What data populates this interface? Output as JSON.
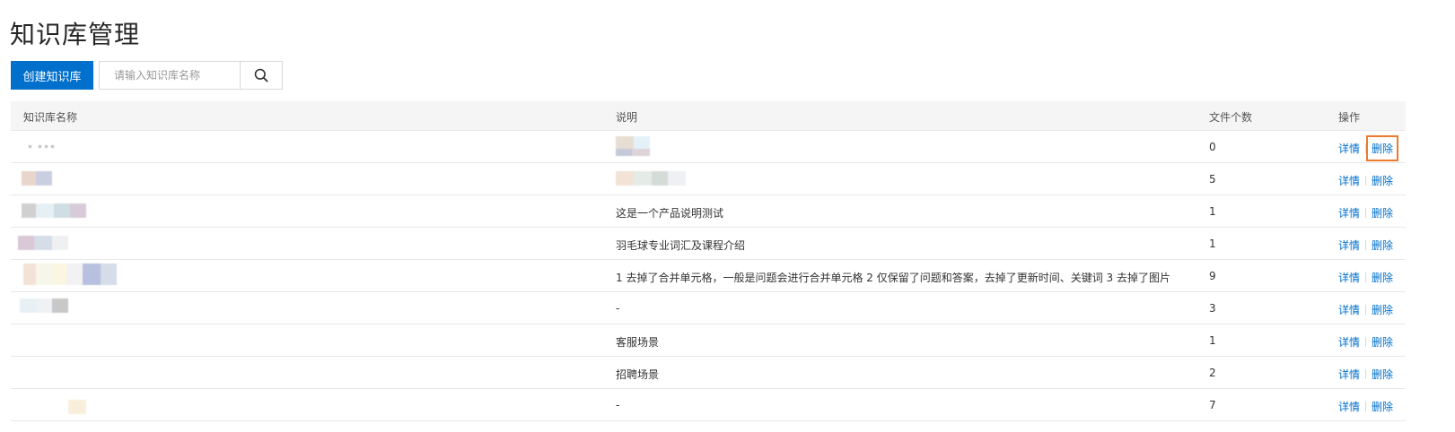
{
  "page_title": "知识库管理",
  "toolbar": {
    "create_label": "创建知识库",
    "search_placeholder": "请输入知识库名称",
    "search_icon": "search-icon"
  },
  "table": {
    "headers": {
      "name": "知识库名称",
      "description": "说明",
      "file_count": "文件个数",
      "actions": "操作"
    },
    "actions": {
      "detail": "详情",
      "delete": "删除"
    },
    "rows": [
      {
        "description": "",
        "file_count": "0"
      },
      {
        "description": "",
        "file_count": "5"
      },
      {
        "description": "这是一个产品说明测试",
        "file_count": "1"
      },
      {
        "description": "羽毛球专业词汇及课程介绍",
        "file_count": "1"
      },
      {
        "description": "1 去掉了合并单元格，一般是问题会进行合并单元格 2 仅保留了问题和答案，去掉了更新时间、关键词 3 去掉了图片",
        "file_count": "9"
      },
      {
        "description": "-",
        "file_count": "3"
      },
      {
        "description": "客服场景",
        "file_count": "1"
      },
      {
        "description": "招聘场景",
        "file_count": "2"
      },
      {
        "description": "-",
        "file_count": "7"
      }
    ]
  },
  "colors": {
    "primary": "#0070cc",
    "highlight": "#ee7a2e"
  }
}
